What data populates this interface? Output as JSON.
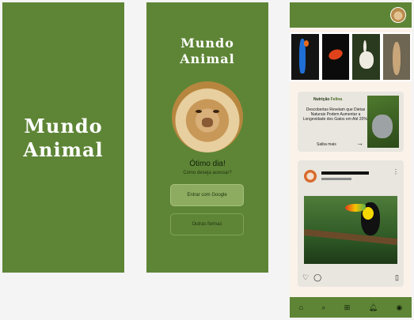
{
  "screen1": {
    "logo_line1": "Mundo",
    "logo_line2": "Animal"
  },
  "screen2": {
    "logo_line1": "Mundo",
    "logo_line2": "Animal",
    "greeting": "Ótimo dia!",
    "prompt": "Como deseja acessar?",
    "google_button": "Entrar com Google",
    "other_button": "Outras formas"
  },
  "screen3": {
    "card": {
      "tag_part1": "Nutrição",
      "tag_part2": "Felina",
      "text": "Descobertas Revelam que Dietas Naturais Podem Aumentar a Longevidade dos Gatos em Até 20%!",
      "link": "Saiba mais",
      "arrow": "→"
    },
    "post_more": "⋮",
    "post_like_icon": "♡",
    "post_comment_icon": "◯",
    "post_save_icon": "▯",
    "nav": {
      "home": "⌂",
      "search": "⌕",
      "add": "⊞",
      "notifications": "🔔︎",
      "profile": "◉"
    }
  },
  "colors": {
    "primary_green": "#5e8536",
    "light_green": "#8dac5f",
    "background": "#fbf2ea"
  }
}
